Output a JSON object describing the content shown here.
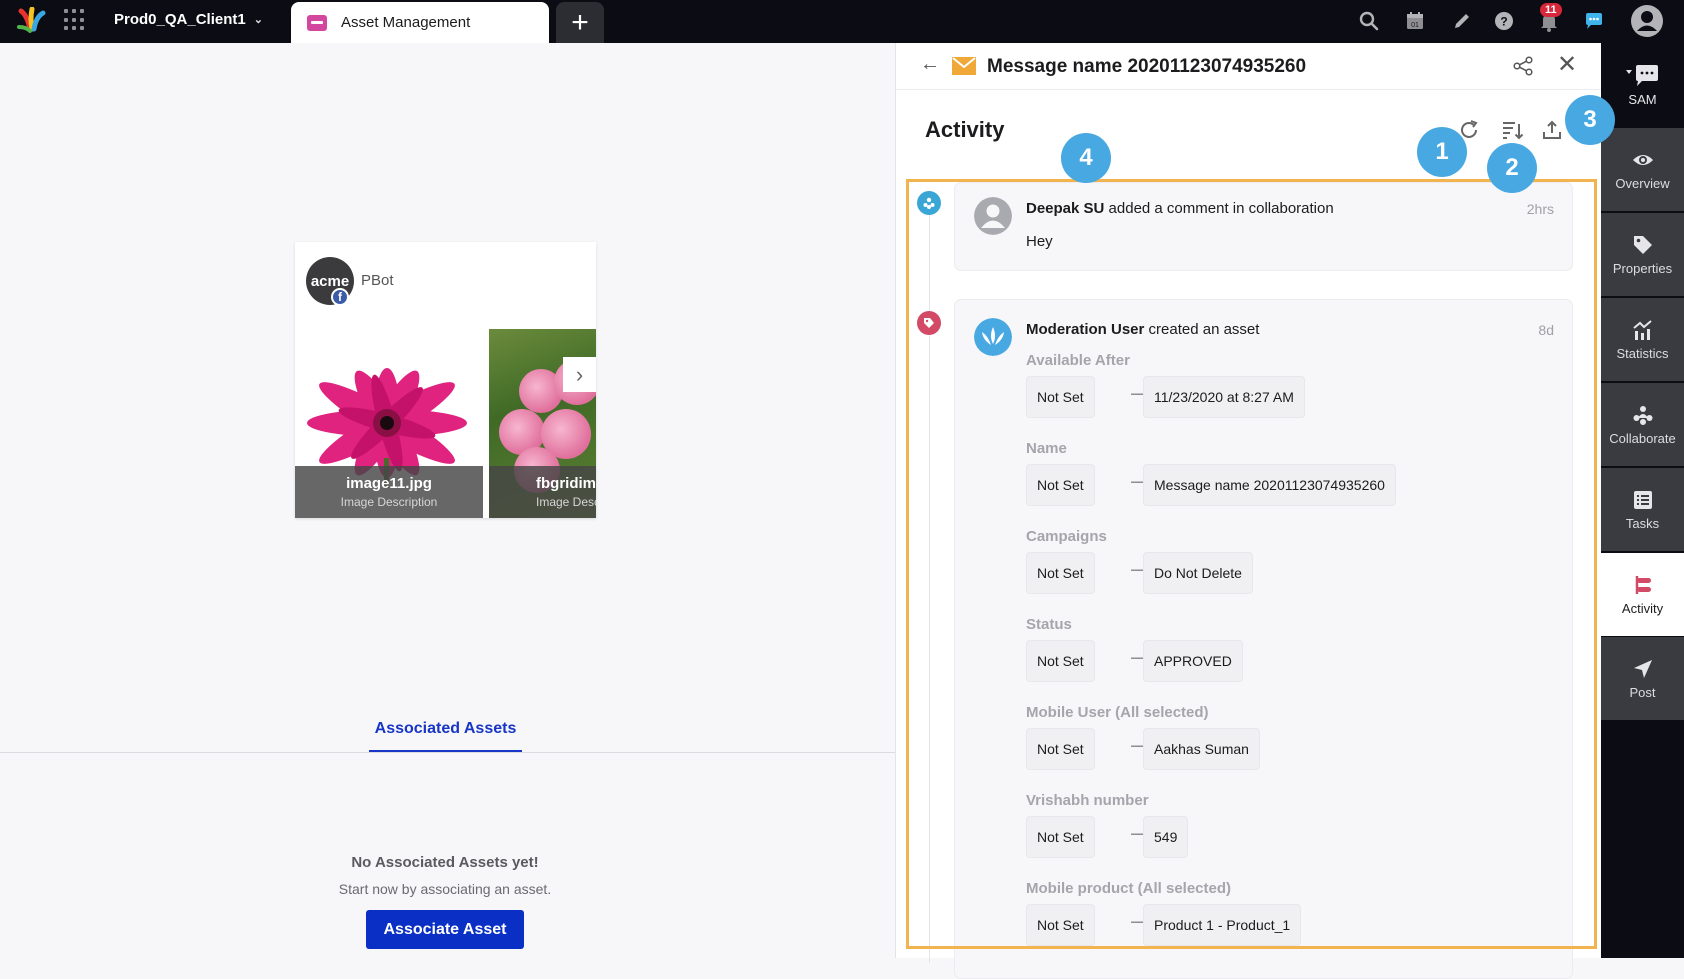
{
  "topbar": {
    "client_name": "Prod0_QA_Client1",
    "active_tab": "Asset Management",
    "new_tab_label": "+",
    "notification_count": "11",
    "icons": [
      "search-icon",
      "calendar-icon",
      "pencil-icon",
      "help-icon",
      "bell-icon",
      "chat-icon",
      "user-avatar-icon"
    ],
    "calendar_day": "01"
  },
  "preview": {
    "account_name": "PBot",
    "avatar_text": "acme",
    "network_badge": "f",
    "images": [
      {
        "title": "image11.jpg",
        "description": "Image Description"
      },
      {
        "title": "fbgridimg",
        "description": "Image Description"
      }
    ]
  },
  "associated": {
    "tab_label": "Associated Assets",
    "empty_title": "No Associated Assets yet!",
    "empty_subtitle": "Start now by associating an asset.",
    "button_label": "Associate Asset"
  },
  "panel": {
    "title": "Message name 20201123074935260",
    "section_title": "Activity",
    "callouts": [
      "1",
      "2",
      "3",
      "4"
    ],
    "activities": [
      {
        "user": "Deepak SU",
        "action": " added a comment in collaboration",
        "time": "2hrs",
        "comment": "Hey",
        "type_icon": "collaborate-icon",
        "type_color": "#3aa6d6"
      },
      {
        "user": "Moderation User",
        "action": " created an asset",
        "time": "8d",
        "type_icon": "tag-icon",
        "type_color": "#d24a66",
        "changes": [
          {
            "field": "Available After",
            "from": "Not Set",
            "to": "11/23/2020 at 8:27 AM"
          },
          {
            "field": "Name",
            "from": "Not Set",
            "to": "Message name 20201123074935260"
          },
          {
            "field": "Campaigns",
            "from": "Not Set",
            "to": "Do Not Delete"
          },
          {
            "field": "Status",
            "from": "Not Set",
            "to": "APPROVED"
          },
          {
            "field": "Mobile User (All selected)",
            "from": "Not Set",
            "to": "Aakhas Suman"
          },
          {
            "field": "Vrishabh number",
            "from": "Not Set",
            "to": "549"
          },
          {
            "field": "Mobile product (All selected)",
            "from": "Not Set",
            "to": "Product 1 - Product_1"
          }
        ]
      }
    ],
    "arrow_glyph": "⟶"
  },
  "sidebar": {
    "top_label": "SAM",
    "items": [
      {
        "label": "Overview",
        "icon": "eye-icon"
      },
      {
        "label": "Properties",
        "icon": "tag-icon"
      },
      {
        "label": "Statistics",
        "icon": "chart-icon"
      },
      {
        "label": "Collaborate",
        "icon": "collaborate-icon"
      },
      {
        "label": "Tasks",
        "icon": "tasks-icon"
      },
      {
        "label": "Activity",
        "icon": "activity-icon",
        "active": true
      },
      {
        "label": "Post",
        "icon": "send-icon"
      }
    ]
  },
  "colors": {
    "accent_blue": "#1736c7",
    "callout_blue": "#48a8e2",
    "highlight_orange": "#f2b44e",
    "activity_red": "#d24a66"
  }
}
